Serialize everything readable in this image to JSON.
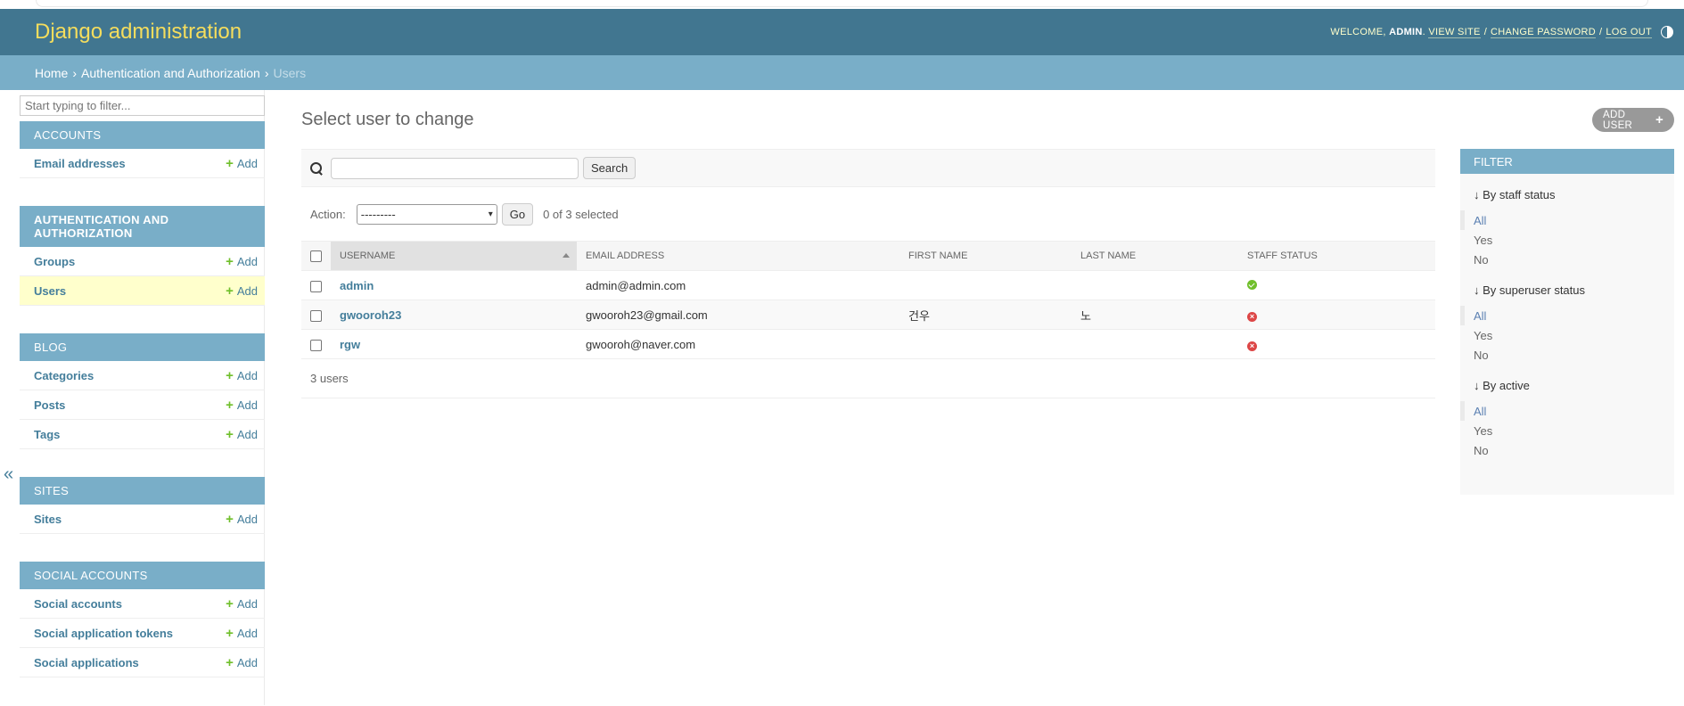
{
  "header": {
    "site_name": "Django administration",
    "welcome_prefix": "WELCOME,",
    "username": "ADMIN",
    "view_site": "VIEW SITE",
    "change_password": "CHANGE PASSWORD",
    "log_out": "LOG OUT",
    "theme_icon": "theme-toggle-icon"
  },
  "breadcrumbs": {
    "home": "Home",
    "section": "Authentication and Authorization",
    "current": "Users"
  },
  "sidebar": {
    "filter_placeholder": "Start typing to filter...",
    "toggle_glyph": "«",
    "add_label": "Add",
    "apps": [
      {
        "caption": "ACCOUNTS",
        "models": [
          "Email addresses"
        ]
      },
      {
        "caption": "AUTHENTICATION AND AUTHORIZATION",
        "models": [
          "Groups",
          "Users"
        ]
      },
      {
        "caption": "BLOG",
        "models": [
          "Categories",
          "Posts",
          "Tags"
        ]
      },
      {
        "caption": "SITES",
        "models": [
          "Sites"
        ]
      },
      {
        "caption": "SOCIAL ACCOUNTS",
        "models": [
          "Social accounts",
          "Social application tokens",
          "Social applications"
        ]
      }
    ]
  },
  "content": {
    "title": "Select user to change",
    "add_button": "ADD USER",
    "search_button": "Search",
    "action_label": "Action:",
    "action_value": "---------",
    "go_button": "Go",
    "selected_counter": "0 of 3 selected",
    "columns": [
      "USERNAME",
      "EMAIL ADDRESS",
      "FIRST NAME",
      "LAST NAME",
      "STAFF STATUS"
    ],
    "rows": [
      {
        "username": "admin",
        "email": "admin@admin.com",
        "first_name": "",
        "last_name": "",
        "staff": "yes"
      },
      {
        "username": "gwooroh23",
        "email": "gwooroh23@gmail.com",
        "first_name": "건우",
        "last_name": "노",
        "staff": "no"
      },
      {
        "username": "rgw",
        "email": "gwooroh@naver.com",
        "first_name": "",
        "last_name": "",
        "staff": "no"
      }
    ],
    "paginator": "3 users"
  },
  "filter": {
    "title": "FILTER",
    "groups": [
      {
        "title": "↓ By staff status",
        "options": [
          "All",
          "Yes",
          "No"
        ]
      },
      {
        "title": "↓ By superuser status",
        "options": [
          "All",
          "Yes",
          "No"
        ]
      },
      {
        "title": "↓ By active",
        "options": [
          "All",
          "Yes",
          "No"
        ]
      }
    ]
  },
  "colors": {
    "header_bg": "#417690",
    "breadcrumb_bg": "#79aec8",
    "site_name": "#f5dd5d",
    "link": "#447e9b",
    "add_green": "#70bf2b",
    "current_row": "#ffffcc"
  }
}
